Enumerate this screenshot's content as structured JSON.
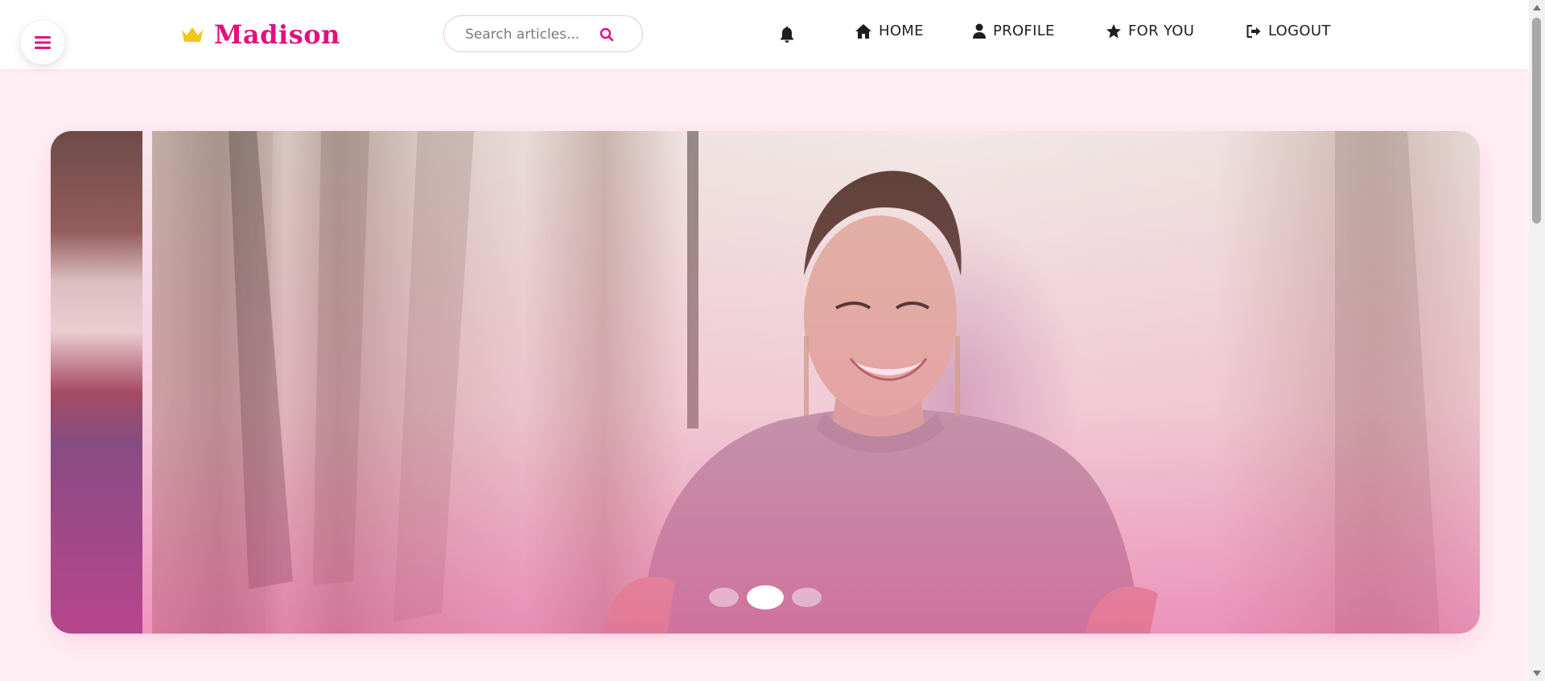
{
  "brand": {
    "name": "Madison",
    "icon": "crown-icon"
  },
  "search": {
    "placeholder": "Search articles...",
    "icon": "search-icon"
  },
  "header": {
    "notification_icon": "bell-icon",
    "nav": [
      {
        "label": "HOME",
        "icon": "home-icon"
      },
      {
        "label": "PROFILE",
        "icon": "user-icon"
      },
      {
        "label": "FOR YOU",
        "icon": "star-icon"
      },
      {
        "label": "LOGOUT",
        "icon": "logout-icon"
      }
    ]
  },
  "hero": {
    "slides_total": 3,
    "active_slide": 2
  },
  "colors": {
    "accent": "#e0117f",
    "crown": "#f5c518",
    "background": "#fff0f5"
  }
}
